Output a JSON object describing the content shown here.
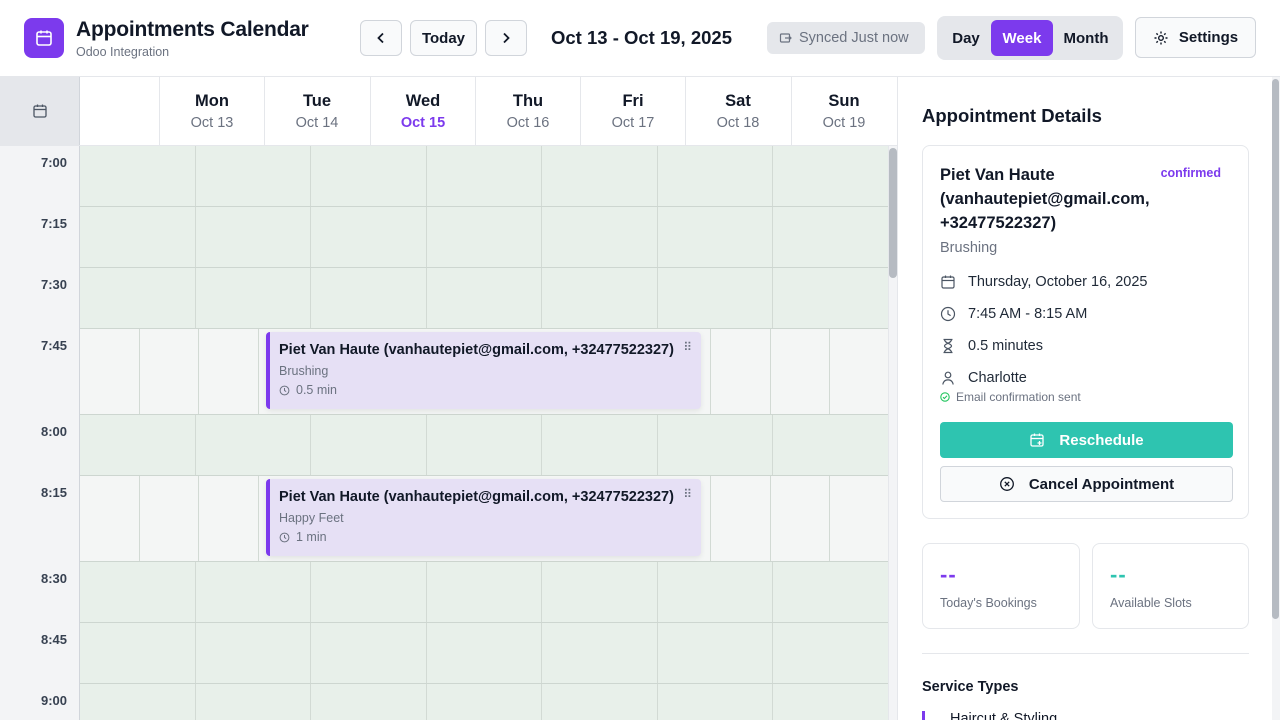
{
  "header": {
    "title": "Appointments Calendar",
    "subtitle": "Odoo Integration",
    "today_label": "Today",
    "date_range": "Oct 13 - Oct 19, 2025",
    "sync_status": "Synced Just now",
    "views": {
      "day": "Day",
      "week": "Week",
      "month": "Month",
      "active": "Week"
    },
    "settings_label": "Settings"
  },
  "calendar": {
    "days": [
      {
        "name": "Mon",
        "date": "Oct 13"
      },
      {
        "name": "Tue",
        "date": "Oct 14"
      },
      {
        "name": "Wed",
        "date": "Oct 15"
      },
      {
        "name": "Thu",
        "date": "Oct 16"
      },
      {
        "name": "Fri",
        "date": "Oct 17"
      },
      {
        "name": "Sat",
        "date": "Oct 18"
      },
      {
        "name": "Sun",
        "date": "Oct 19"
      }
    ],
    "today_index": 2,
    "times": [
      "7:00",
      "7:15",
      "7:30",
      "7:45",
      "8:00",
      "8:15",
      "8:30",
      "8:45",
      "9:00"
    ],
    "events": [
      {
        "title": "Piet Van Haute (vanhautepiet@gmail.com, +32477522327)",
        "service": "Brushing",
        "duration": "0.5 min"
      },
      {
        "title": "Piet Van Haute (vanhautepiet@gmail.com, +32477522327)",
        "service": "Happy Feet",
        "duration": "1 min"
      }
    ]
  },
  "details": {
    "panel_title": "Appointment Details",
    "client": "Piet Van Haute (vanhautepiet@gmail.com, +32477522327)",
    "status": "confirmed",
    "service": "Brushing",
    "date": "Thursday, October 16, 2025",
    "time": "7:45 AM - 8:15 AM",
    "duration": "0.5 minutes",
    "staff": "Charlotte",
    "email_status": "Email confirmation sent",
    "reschedule_label": "Reschedule",
    "cancel_label": "Cancel Appointment"
  },
  "stats": {
    "bookings_value": "--",
    "bookings_label": "Today's Bookings",
    "slots_value": "--",
    "slots_label": "Available Slots"
  },
  "service_types": {
    "title": "Service Types",
    "first_item": "Haircut & Styling"
  },
  "colors": {
    "accent": "#7c3aed",
    "teal": "#2ec4b0",
    "event_bg": "#e6e0f5",
    "slot_bg": "#e8f0ea"
  }
}
